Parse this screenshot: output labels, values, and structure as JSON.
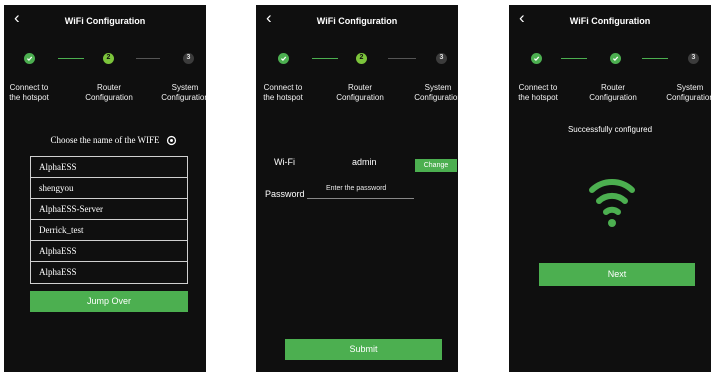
{
  "colors": {
    "accent": "#4caf50",
    "background": "#0f0f0f",
    "step_current": "#7cc43b",
    "step_todo": "#3c3c3c"
  },
  "screens": [
    {
      "back_icon": "chevron-left-icon",
      "title": "WiFi Configuration",
      "steps": [
        {
          "number": "1",
          "state": "done",
          "label": "Connect to\nthe hotspot"
        },
        {
          "number": "2",
          "state": "current",
          "label": "Router\nConfiguration"
        },
        {
          "number": "3",
          "state": "todo",
          "label": "System\nConfiguration"
        }
      ],
      "choose_label": "Choose the name of the WIFE",
      "refresh_icon": "refresh-icon",
      "networks": [
        "AlphaESS",
        "shengyou",
        "AlphaESS-Server",
        "Derrick_test",
        "AlphaESS",
        "AlphaESS"
      ],
      "jump_over_label": "Jump Over"
    },
    {
      "back_icon": "chevron-left-icon",
      "title": "WiFi Configuration",
      "steps": [
        {
          "number": "1",
          "state": "done",
          "label": "Connect to\nthe hotspot"
        },
        {
          "number": "2",
          "state": "current",
          "label": "Router\nConfiguration"
        },
        {
          "number": "3",
          "state": "todo",
          "label": "System\nConfiguration"
        }
      ],
      "wifi_label": "Wi-Fi",
      "wifi_value": "admin",
      "change_label": "Change",
      "password_label": "Password",
      "password_placeholder": "Enter  the password",
      "submit_label": "Submit"
    },
    {
      "back_icon": "chevron-left-icon",
      "title": "WiFi Configuration",
      "steps": [
        {
          "number": "1",
          "state": "done",
          "label": "Connect to\nthe hotspot"
        },
        {
          "number": "2",
          "state": "done",
          "label": "Router\nConfiguration"
        },
        {
          "number": "3",
          "state": "todo",
          "label": "System\nConfiguration"
        }
      ],
      "success_text": "Successfully configured",
      "wifi_icon": "wifi-signal-icon",
      "next_label": "Next"
    }
  ]
}
